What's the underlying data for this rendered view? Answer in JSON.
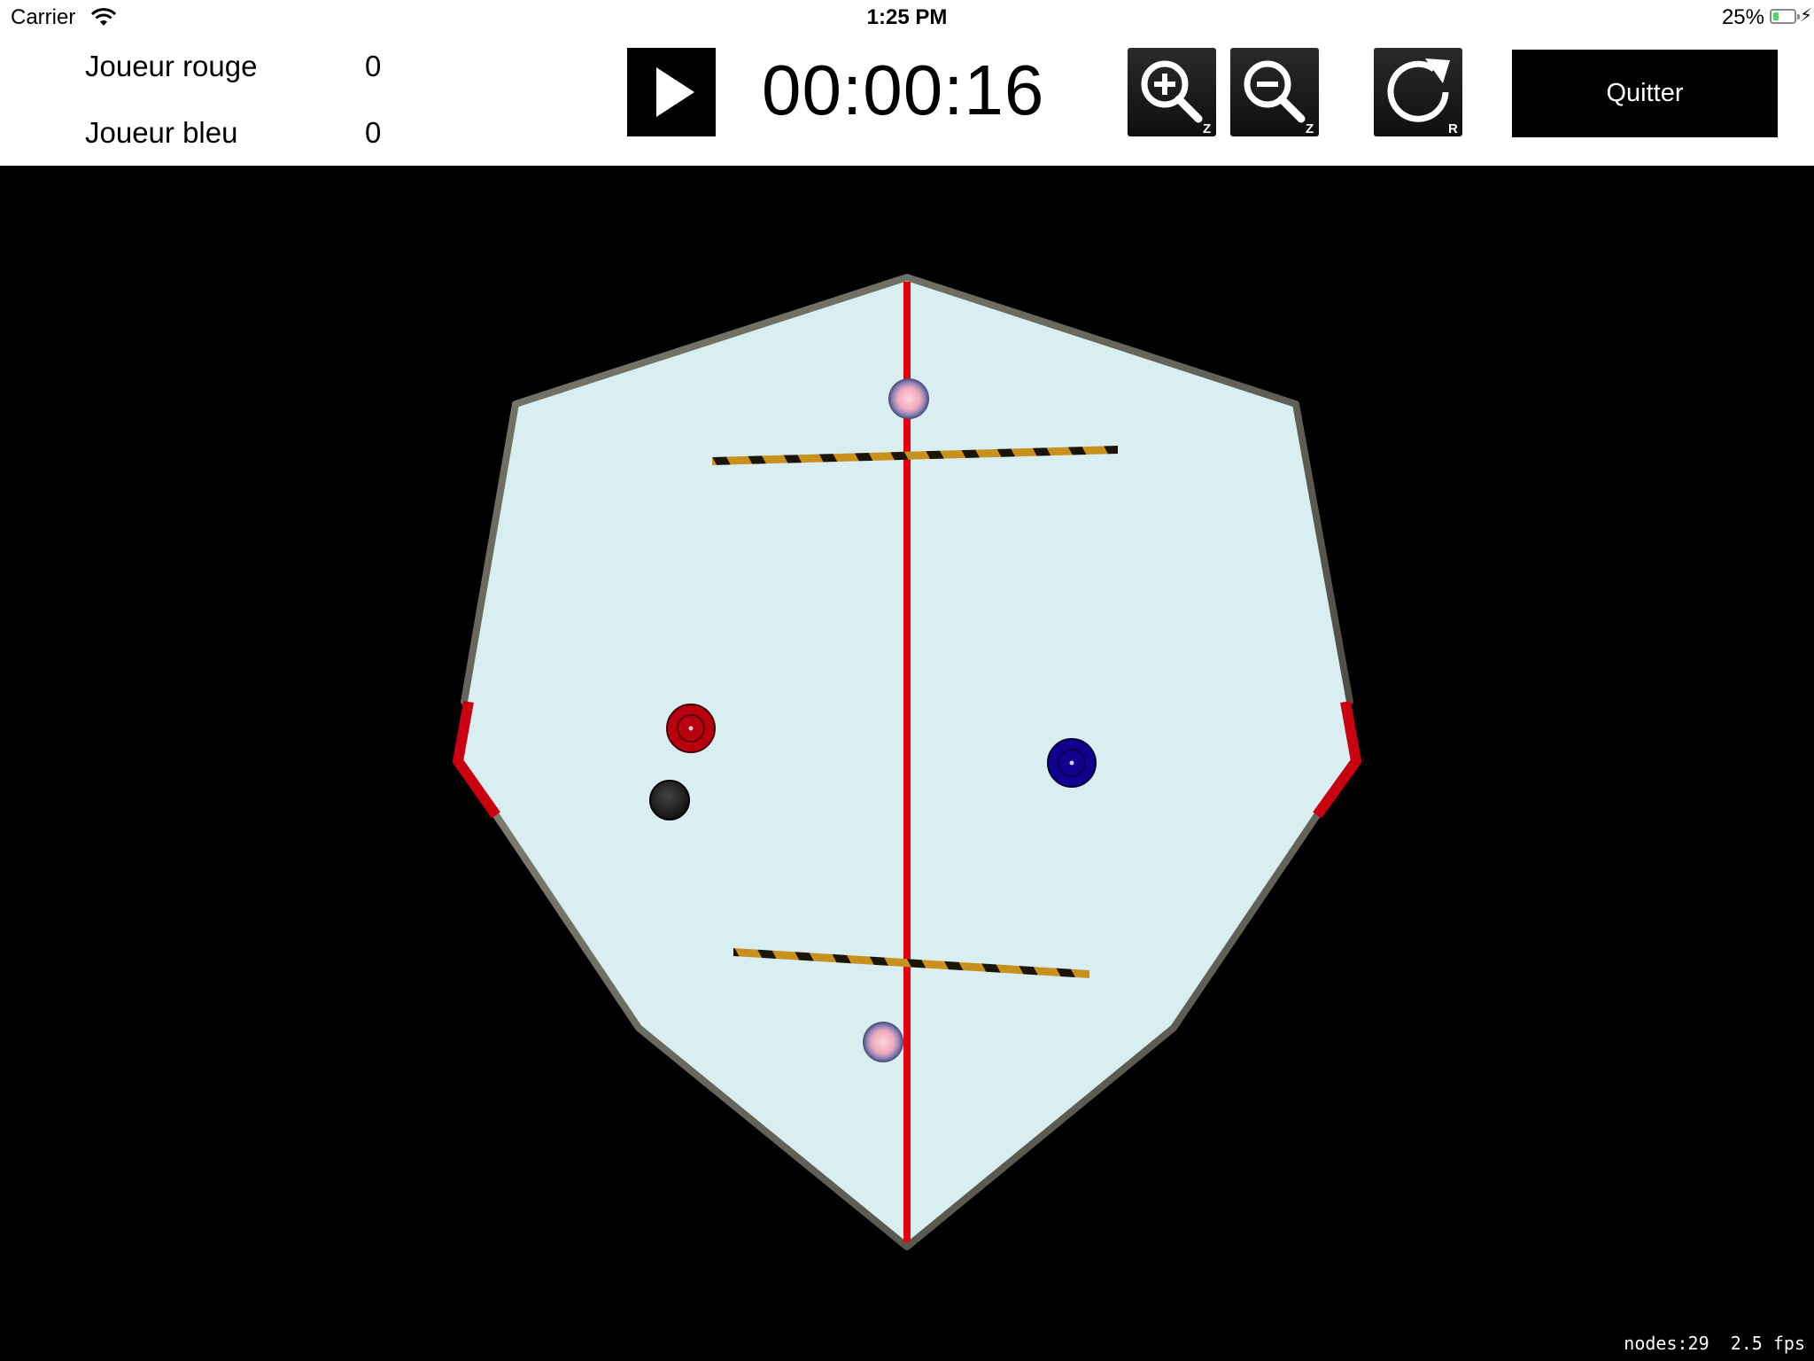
{
  "status_bar": {
    "carrier": "Carrier",
    "time": "1:25 PM",
    "battery_percent": "25%",
    "battery_level": 0.25,
    "icons": [
      "wifi-icon",
      "battery-icon",
      "charging-bolt-icon"
    ]
  },
  "scoreboard": {
    "players": [
      {
        "name": "Joueur rouge",
        "score": "0",
        "color": "#c8000f"
      },
      {
        "name": "Joueur bleu",
        "score": "0",
        "color": "#1a0aa8"
      }
    ]
  },
  "controls": {
    "play_icon": "play-icon",
    "timer": "00:00:16",
    "zoom_in": {
      "icon": "zoom-in-icon",
      "key": "Z"
    },
    "zoom_out": {
      "icon": "zoom-out-icon",
      "key": "Z"
    },
    "reset": {
      "icon": "reset-icon",
      "key": "R"
    },
    "quit_label": "Quitter"
  },
  "table": {
    "surface_color": "#d9eef1",
    "border_color": "#555555",
    "goal_color": "#c8000f",
    "center_line_color": "#e8000f",
    "mallets": [
      {
        "player": "Joueur rouge",
        "color": "#b8000f"
      },
      {
        "player": "Joueur bleu",
        "color": "#12008f"
      }
    ],
    "puck_color": "#222222",
    "obstacles": [
      "yellow-black-striped-bar",
      "yellow-black-striped-bar"
    ],
    "portals": [
      "portal",
      "portal"
    ]
  },
  "debug": {
    "nodes": "nodes:29",
    "fps": "2.5 fps"
  }
}
